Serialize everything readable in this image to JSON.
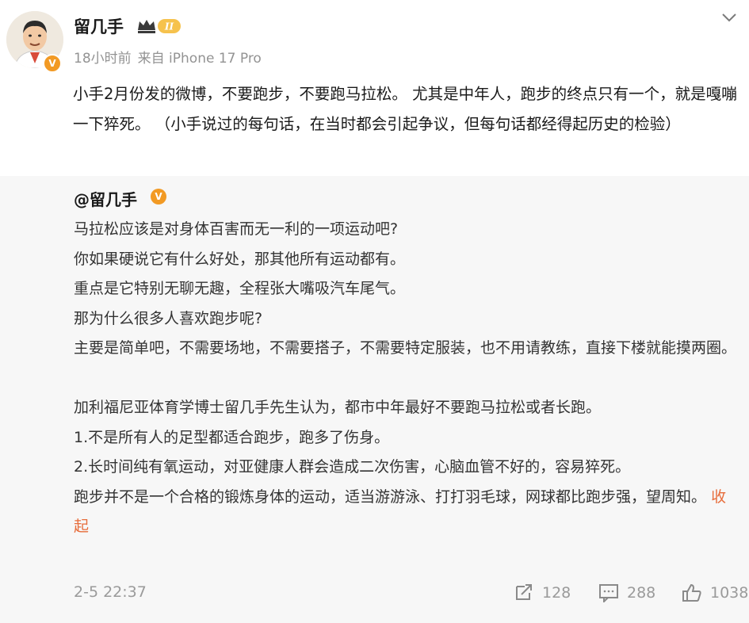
{
  "post": {
    "username": "留几手",
    "level_badge": "II",
    "time": "18小时前",
    "source": "来自 iPhone 17 Pro",
    "text_lead": "小手2月份发的微博，不要跑步，不要跑马拉松。",
    "text_rest": "尤其是中年人，跑步的终点只有一个，就是嘎嘣一下猝死。  （小手说过的每句话，在当时都会引起争议，但每句话都经得起历史的检验）"
  },
  "quoted": {
    "author": "@留几手",
    "lines": [
      "马拉松应该是对身体百害而无一利的一项运动吧?",
      "你如果硬说它有什么好处，那其他所有运动都有。",
      "重点是它特别无聊无趣，全程张大嘴吸汽车尾气。",
      "那为什么很多人喜欢跑步呢?",
      "主要是简单吧，不需要场地，不需要搭子，不需要特定服装，也不用请教练，直接下楼就能摸两圈。"
    ],
    "lines2": [
      "加利福尼亚体育学博士留几手先生认为，都市中年最好不要跑马拉松或者长跑。",
      "1.不是所有人的足型都适合跑步，跑多了伤身。",
      "2.长时间纯有氧运动，对亚健康人群会造成二次伤害，心脑血管不好的，容易猝死。"
    ],
    "last_line": "跑步并不是一个合格的锻炼身体的运动，适当游游泳、打打羽毛球，网球都比跑步强，望周知。",
    "collapse_label": "收起",
    "timestamp": "2-5 22:37",
    "reposts": "128",
    "comments": "288",
    "likes": "1038"
  },
  "colors": {
    "accent_orange": "#e76c3a",
    "verified_badge": "#f29a24",
    "quote_bg": "#f7f7f7",
    "meta_gray": "#939393"
  },
  "icons": {
    "verified": "verified-v-badge",
    "level": "crown-level-icon",
    "more": "chevron-down-icon",
    "repost": "repost-icon",
    "comment": "comment-icon",
    "like": "thumbs-up-icon"
  }
}
